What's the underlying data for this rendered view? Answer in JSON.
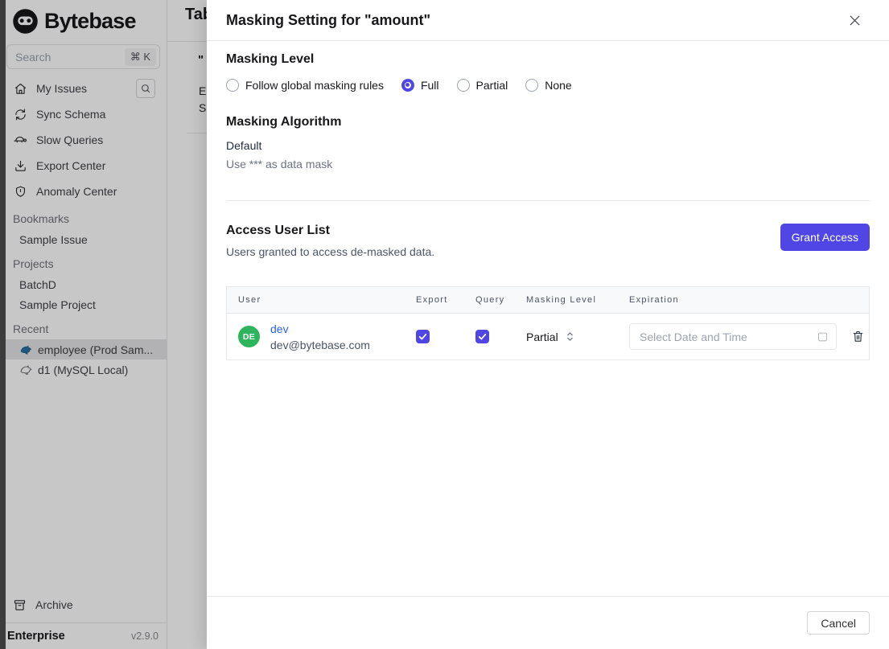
{
  "colors": {
    "accent": "#4f46e5",
    "link": "#2563eb",
    "avatarGreen": "#2db55d"
  },
  "sidebar": {
    "logo_text": "Bytebase",
    "search": {
      "placeholder": "Search",
      "shortcut": "⌘ K"
    },
    "nav": [
      {
        "label": "My Issues",
        "icon": "home-icon"
      },
      {
        "label": "Sync Schema",
        "icon": "sync-icon"
      },
      {
        "label": "Slow Queries",
        "icon": "turtle-icon"
      },
      {
        "label": "Export Center",
        "icon": "download-icon"
      },
      {
        "label": "Anomaly Center",
        "icon": "shield-icon"
      }
    ],
    "sections": [
      {
        "label": "Bookmarks",
        "items": [
          {
            "label": "Sample Issue"
          }
        ]
      },
      {
        "label": "Projects",
        "items": [
          {
            "label": "BatchD"
          },
          {
            "label": "Sample Project"
          }
        ]
      },
      {
        "label": "Recent",
        "items": [
          {
            "label": "employee (Prod Sam...",
            "icon": "mysql-dolphin-icon",
            "selected": true
          },
          {
            "label": "d1 (MySQL Local)",
            "icon": "dolphin-outline-icon",
            "selected": false
          }
        ]
      }
    ],
    "archive_label": "Archive",
    "plan_label": "Enterprise",
    "version": "v2.9.0"
  },
  "background_page": {
    "title_fragment": "Tab",
    "quote_fragment": "\"",
    "line1_fragment": "E",
    "line2_fragment": "S"
  },
  "modal": {
    "title": "Masking Setting for \"amount\"",
    "masking_level": {
      "heading": "Masking Level",
      "options": [
        {
          "label": "Follow global masking rules",
          "selected": false
        },
        {
          "label": "Full",
          "selected": true
        },
        {
          "label": "Partial",
          "selected": false
        },
        {
          "label": "None",
          "selected": false
        }
      ]
    },
    "masking_algorithm": {
      "heading": "Masking Algorithm",
      "name": "Default",
      "description": "Use *** as data mask"
    },
    "access_user_list": {
      "heading": "Access User List",
      "description": "Users granted to access de-masked data.",
      "grant_button": "Grant Access",
      "table": {
        "columns": [
          "User",
          "Export",
          "Query",
          "Masking Level",
          "Expiration"
        ],
        "rows": [
          {
            "avatar_initials": "DE",
            "name": "dev",
            "email": "dev@bytebase.com",
            "export_checked": true,
            "query_checked": true,
            "masking_level": "Partial",
            "expiration_placeholder": "Select Date and Time"
          }
        ]
      }
    },
    "footer": {
      "cancel_label": "Cancel"
    }
  }
}
